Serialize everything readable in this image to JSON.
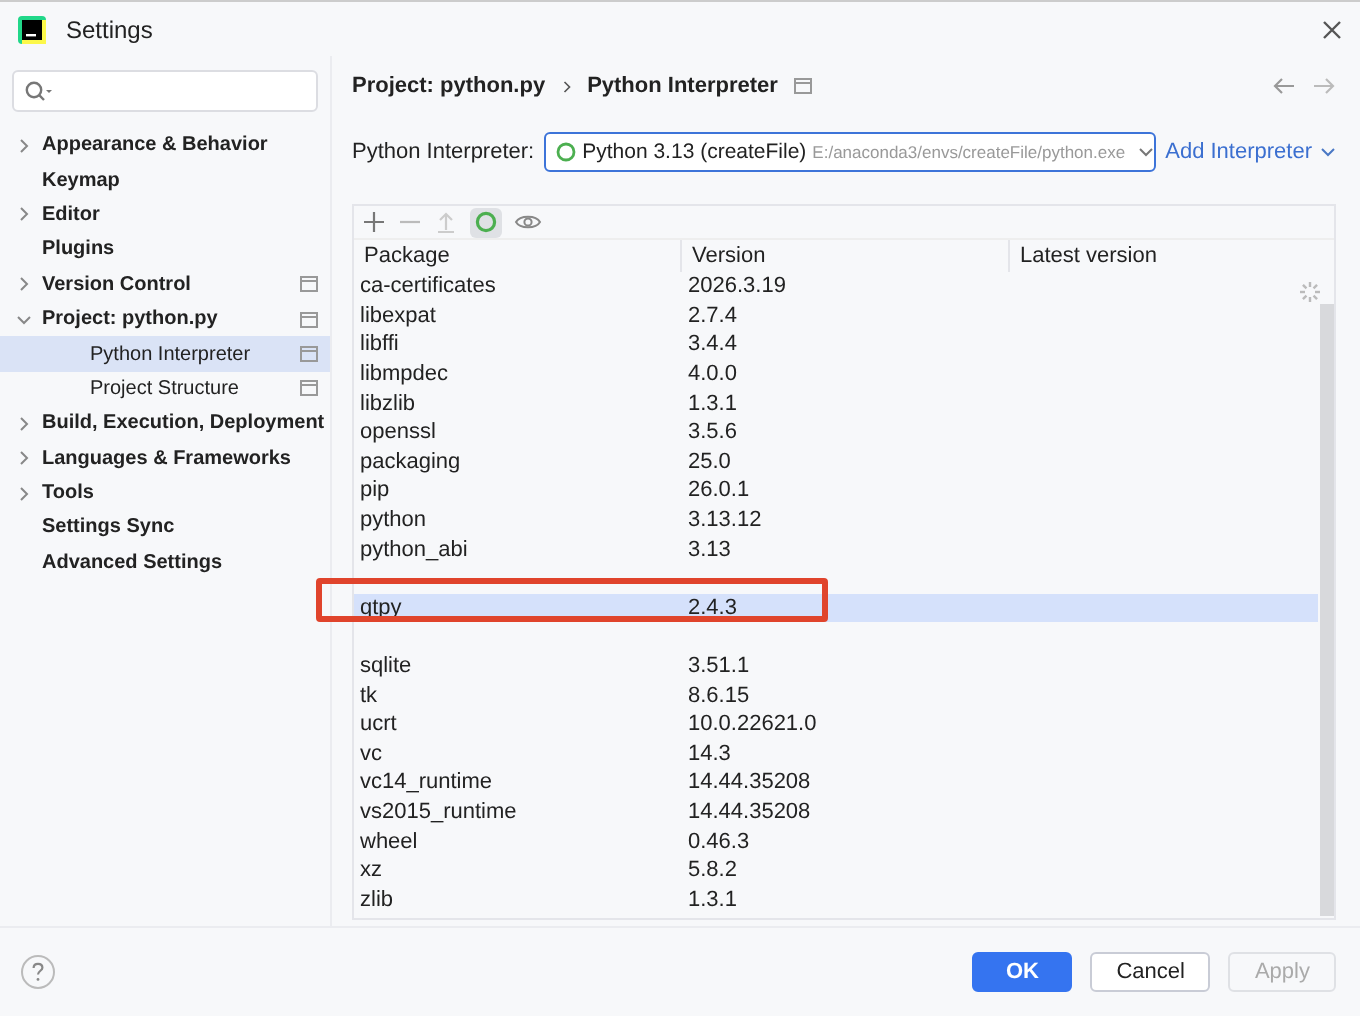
{
  "window": {
    "title": "Settings"
  },
  "sidebar": {
    "items": [
      {
        "label": "Appearance & Behavior",
        "kind": "group",
        "expanded": false,
        "project_scoped": false,
        "selected": false
      },
      {
        "label": "Keymap",
        "kind": "page",
        "project_scoped": false,
        "selected": false
      },
      {
        "label": "Editor",
        "kind": "group",
        "expanded": false,
        "project_scoped": false,
        "selected": false
      },
      {
        "label": "Plugins",
        "kind": "page",
        "project_scoped": false,
        "selected": false
      },
      {
        "label": "Version Control",
        "kind": "group",
        "expanded": false,
        "project_scoped": true,
        "selected": false
      },
      {
        "label": "Project: python.py",
        "kind": "group",
        "expanded": true,
        "project_scoped": true,
        "selected": false,
        "children": [
          {
            "label": "Python Interpreter",
            "project_scoped": true,
            "selected": true
          },
          {
            "label": "Project Structure",
            "project_scoped": true,
            "selected": false
          }
        ]
      },
      {
        "label": "Build, Execution, Deployment",
        "kind": "group",
        "expanded": false,
        "project_scoped": false,
        "selected": false
      },
      {
        "label": "Languages & Frameworks",
        "kind": "group",
        "expanded": false,
        "project_scoped": false,
        "selected": false
      },
      {
        "label": "Tools",
        "kind": "group",
        "expanded": false,
        "project_scoped": false,
        "selected": false
      },
      {
        "label": "Settings Sync",
        "kind": "page",
        "project_scoped": false,
        "selected": false
      },
      {
        "label": "Advanced Settings",
        "kind": "page",
        "project_scoped": false,
        "selected": false
      }
    ]
  },
  "breadcrumb": {
    "items": [
      "Project: python.py",
      "Python Interpreter"
    ],
    "project_scoped": true
  },
  "interpreter": {
    "label": "Python Interpreter:",
    "name": "Python 3.13 (createFile)",
    "path": "E:/anaconda3/envs/createFile/python.exe",
    "add_link": "Add Interpreter"
  },
  "table": {
    "columns": [
      "Package",
      "Version",
      "Latest version"
    ],
    "rows": [
      {
        "package": "ca-certificates",
        "version": "2026.3.19",
        "selected": false,
        "highlighted": false
      },
      {
        "package": "libexpat",
        "version": "2.7.4",
        "selected": false,
        "highlighted": false
      },
      {
        "package": "libffi",
        "version": "3.4.4",
        "selected": false,
        "highlighted": false
      },
      {
        "package": "libmpdec",
        "version": "4.0.0",
        "selected": false,
        "highlighted": false
      },
      {
        "package": "libzlib",
        "version": "1.3.1",
        "selected": false,
        "highlighted": false
      },
      {
        "package": "openssl",
        "version": "3.5.6",
        "selected": false,
        "highlighted": false
      },
      {
        "package": "packaging",
        "version": "25.0",
        "selected": false,
        "highlighted": false
      },
      {
        "package": "pip",
        "version": "26.0.1",
        "selected": false,
        "highlighted": false
      },
      {
        "package": "python",
        "version": "3.13.12",
        "selected": false,
        "highlighted": false
      },
      {
        "package": "python_abi",
        "version": "3.13",
        "selected": false,
        "highlighted": false
      },
      {
        "package": "qtpy",
        "version": "2.4.3",
        "selected": true,
        "highlighted": true
      },
      {
        "package": "sqlite",
        "version": "3.51.1",
        "selected": false,
        "highlighted": false
      },
      {
        "package": "tk",
        "version": "8.6.15",
        "selected": false,
        "highlighted": false
      },
      {
        "package": "ucrt",
        "version": "10.0.22621.0",
        "selected": false,
        "highlighted": false
      },
      {
        "package": "vc",
        "version": "14.3",
        "selected": false,
        "highlighted": false
      },
      {
        "package": "vc14_runtime",
        "version": "14.44.35208",
        "selected": false,
        "highlighted": false
      },
      {
        "package": "vs2015_runtime",
        "version": "14.44.35208",
        "selected": false,
        "highlighted": false
      },
      {
        "package": "wheel",
        "version": "0.46.3",
        "selected": false,
        "highlighted": false
      },
      {
        "package": "xz",
        "version": "5.8.2",
        "selected": false,
        "highlighted": false
      },
      {
        "package": "zlib",
        "version": "1.3.1",
        "selected": false,
        "highlighted": false
      }
    ]
  },
  "buttons": [
    {
      "label": "OK",
      "kind": "primary",
      "disabled": false
    },
    {
      "label": "Cancel",
      "kind": "secondary",
      "disabled": false
    },
    {
      "label": "Apply",
      "kind": "secondary",
      "disabled": true
    }
  ]
}
